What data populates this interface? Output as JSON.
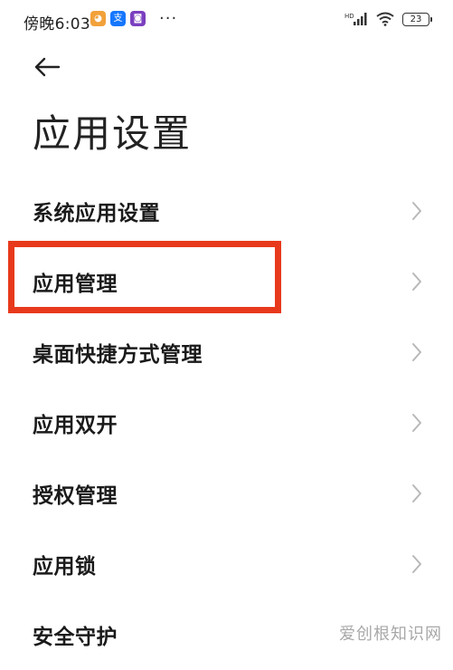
{
  "status_bar": {
    "time": "傍晚6:03",
    "notification_icons": [
      {
        "name": "emoji-app-icon",
        "color": "#f2a13b",
        "glyph": "◕"
      },
      {
        "name": "alipay-app-icon",
        "color": "#1677ff",
        "glyph": "支"
      },
      {
        "name": "purple-app-icon",
        "color": "#7b3fbf",
        "glyph": "◙"
      }
    ],
    "more_indicator": "···",
    "signal_label": "HD",
    "battery_level": "23"
  },
  "header": {
    "back_icon": "arrow-left-icon",
    "title": "应用设置"
  },
  "menu": {
    "items": [
      {
        "label": "系统应用设置"
      },
      {
        "label": "应用管理",
        "highlighted": true
      },
      {
        "label": "桌面快捷方式管理"
      },
      {
        "label": "应用双开"
      },
      {
        "label": "授权管理"
      },
      {
        "label": "应用锁"
      },
      {
        "label": "安全守护"
      }
    ]
  },
  "annotation": {
    "highlight_color": "#e8391c"
  },
  "watermark": {
    "text": "爱创根知识网"
  }
}
